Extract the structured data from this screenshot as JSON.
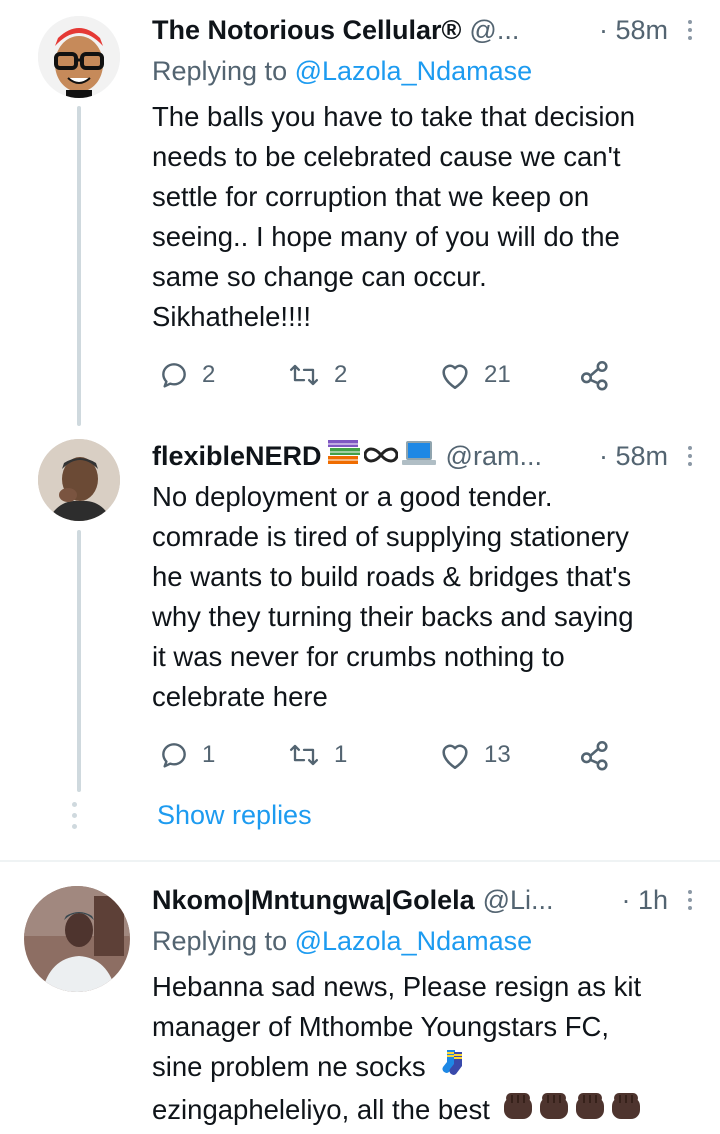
{
  "tweets": [
    {
      "name": "The Notorious Cellular®",
      "handle": "@...",
      "time": "· 58m",
      "replying_prefix": "Replying to ",
      "replying_to": "@Lazola_Ndamase",
      "text": "The balls you have to take that decision\nneeds to be celebrated cause we can't\nsettle for corruption that we keep on\nseeing.. I hope many of you will do the\nsame so change can occur.\nSikhathele!!!!",
      "replies": "2",
      "retweets": "2",
      "likes": "21"
    },
    {
      "name": "flexibleNERD",
      "handle": "@ram...",
      "time": "· 58m",
      "text": "No deployment or a good tender.\ncomrade is tired of supplying stationery\nhe wants to build roads & bridges that's\nwhy they turning their backs and saying\nit was never for crumbs nothing to\ncelebrate here",
      "replies": "1",
      "retweets": "1",
      "likes": "13"
    },
    {
      "name": "Nkomo|Mntungwa|Golela",
      "handle": "@Li...",
      "time": "· 1h",
      "replying_prefix": "Replying to ",
      "replying_to": "@Lazola_Ndamase",
      "text_lines": [
        "Hebanna sad news, Please resign as kit",
        "manager of Mthombe Youngstars FC,",
        "sine problem ne socks",
        "ezingapheleliyo, all the best"
      ]
    }
  ],
  "show_replies": "Show replies",
  "colors": {
    "accent": "#1d9bf0",
    "secondary_text": "#536471",
    "thread_line": "#cfd9de",
    "divider": "#eff3f4"
  }
}
